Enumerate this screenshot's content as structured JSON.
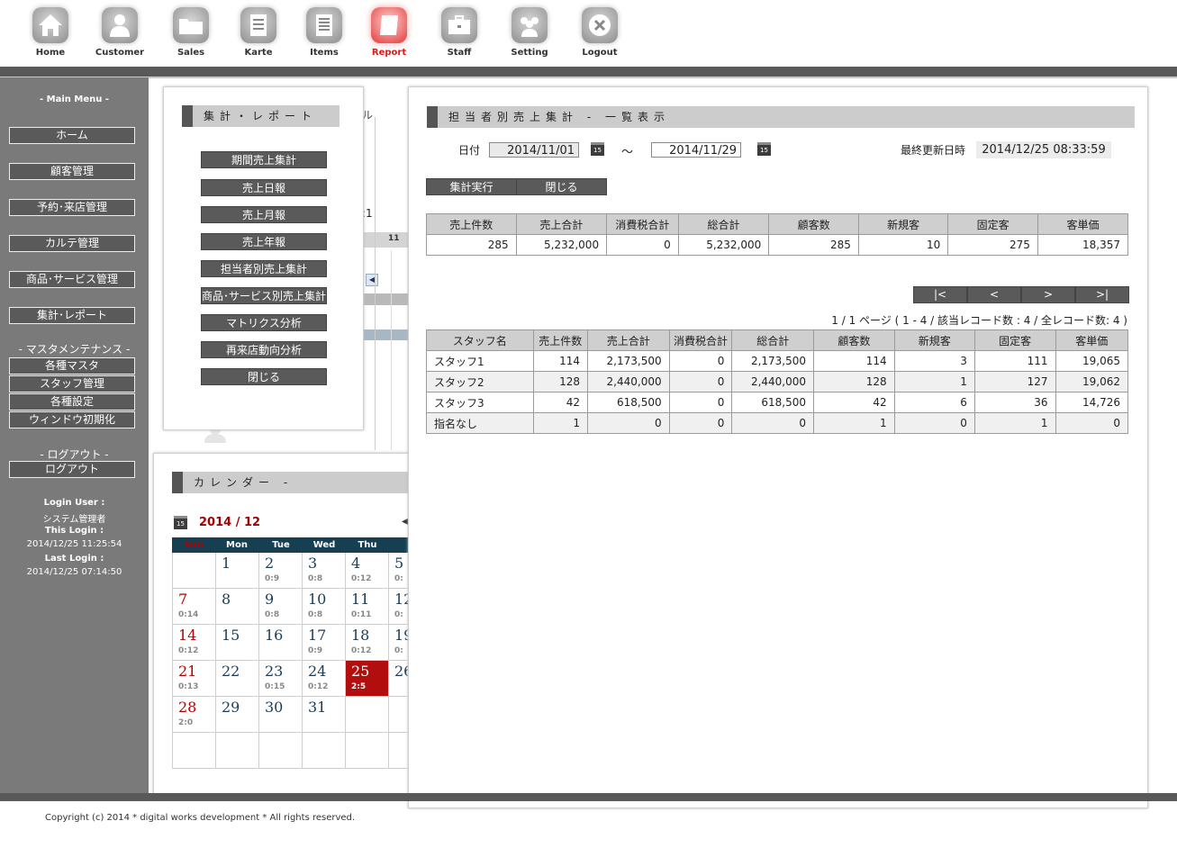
{
  "nav": [
    {
      "label": "Home",
      "icon": "home-icon"
    },
    {
      "label": "Customer",
      "icon": "person-icon"
    },
    {
      "label": "Sales",
      "icon": "folder-icon"
    },
    {
      "label": "Karte",
      "icon": "document-icon"
    },
    {
      "label": "Items",
      "icon": "list-document-icon"
    },
    {
      "label": "Report",
      "icon": "scroll-icon",
      "active": true
    },
    {
      "label": "Staff",
      "icon": "briefcase-icon"
    },
    {
      "label": "Setting",
      "icon": "group-icon"
    },
    {
      "label": "Logout",
      "icon": "close-circle-icon"
    }
  ],
  "sidebar": {
    "main_menu_head": "- Main Menu -",
    "items": [
      "ホーム",
      "顧客管理",
      "予約･来店管理",
      "カルテ管理",
      "商品･サービス管理",
      "集計･レポート"
    ],
    "master_head": "- マスタメンテナンス -",
    "master_items": [
      "各種マスタ",
      "スタッフ管理",
      "各種設定",
      "ウィンドウ初期化"
    ],
    "logout_head": "- ログアウト -",
    "logout_item": "ログアウト",
    "login_user_label": "Login User :",
    "login_user": "システム管理者",
    "this_login_label": "This Login :",
    "this_login": "2014/12/25 11:25:54",
    "last_login_label": "Last Login :",
    "last_login": "2014/12/25 07:14:50"
  },
  "report_menu": {
    "title": "集計・レポート",
    "items": [
      "期間売上集計",
      "売上日報",
      "売上月報",
      "売上年報",
      "担当者別売上集計",
      "商品･サービス別売上集計",
      "マトリクス分析",
      "再来店動向分析",
      "閉じる"
    ]
  },
  "background_fragments": {
    "title_tail": "ル",
    "ratio": ":1",
    "col11": "11"
  },
  "calendar": {
    "title": "カレンダー -",
    "month": "2014 / 12",
    "days": [
      "Sun",
      "Mon",
      "Tue",
      "Wed",
      "Thu"
    ],
    "rows": [
      [
        {
          "n": "",
          "s": ""
        },
        {
          "n": "1",
          "s": ""
        },
        {
          "n": "2",
          "s": "0:9"
        },
        {
          "n": "3",
          "s": "0:8"
        },
        {
          "n": "4",
          "s": "0:12"
        },
        {
          "n": "5",
          "s": "0:"
        }
      ],
      [
        {
          "n": "7",
          "s": "0:14"
        },
        {
          "n": "8",
          "s": ""
        },
        {
          "n": "9",
          "s": "0:8"
        },
        {
          "n": "10",
          "s": "0:8"
        },
        {
          "n": "11",
          "s": "0:11"
        },
        {
          "n": "12",
          "s": "0:"
        }
      ],
      [
        {
          "n": "14",
          "s": "0:12"
        },
        {
          "n": "15",
          "s": ""
        },
        {
          "n": "16",
          "s": ""
        },
        {
          "n": "17",
          "s": "0:9"
        },
        {
          "n": "18",
          "s": "0:12"
        },
        {
          "n": "19",
          "s": "0:"
        }
      ],
      [
        {
          "n": "21",
          "s": "0:13"
        },
        {
          "n": "22",
          "s": ""
        },
        {
          "n": "23",
          "s": "0:15"
        },
        {
          "n": "24",
          "s": "0:12"
        },
        {
          "n": "25",
          "s": "2:5",
          "today": true
        },
        {
          "n": "26",
          "s": ""
        }
      ],
      [
        {
          "n": "28",
          "s": "2:0"
        },
        {
          "n": "29",
          "s": ""
        },
        {
          "n": "30",
          "s": ""
        },
        {
          "n": "31",
          "s": ""
        },
        {
          "n": "",
          "s": ""
        },
        {
          "n": "",
          "s": ""
        }
      ],
      [
        {
          "n": "",
          "s": ""
        },
        {
          "n": "",
          "s": ""
        },
        {
          "n": "",
          "s": ""
        },
        {
          "n": "",
          "s": ""
        },
        {
          "n": "",
          "s": ""
        },
        {
          "n": "",
          "s": ""
        }
      ]
    ]
  },
  "report": {
    "title": "担当者別売上集計 - 一覧表示",
    "date_label": "日付",
    "date_from": "2014/11/01",
    "tilde": "～",
    "date_to": "2014/11/29",
    "updated_label": "最終更新日時",
    "updated_value": "2014/12/25 08:33:59",
    "run_label": "集計実行",
    "close_label": "閉じる",
    "summary_headers": [
      "売上件数",
      "売上合計",
      "消費税合計",
      "総合計",
      "顧客数",
      "新規客",
      "固定客",
      "客単価"
    ],
    "summary_values": [
      "285",
      "5,232,000",
      "0",
      "5,232,000",
      "285",
      "10",
      "275",
      "18,357"
    ],
    "pager": [
      "|<",
      "<",
      ">",
      ">|"
    ],
    "page_info": "1 / 1 ページ ( 1 - 4 / 該当レコード数 : 4 / 全レコード数: 4 )",
    "detail_headers": [
      "スタッフ名",
      "売上件数",
      "売上合計",
      "消費税合計",
      "総合計",
      "顧客数",
      "新規客",
      "固定客",
      "客単価"
    ],
    "detail_rows": [
      [
        "スタッフ1",
        "114",
        "2,173,500",
        "0",
        "2,173,500",
        "114",
        "3",
        "111",
        "19,065"
      ],
      [
        "スタッフ2",
        "128",
        "2,440,000",
        "0",
        "2,440,000",
        "128",
        "1",
        "127",
        "19,062"
      ],
      [
        "スタッフ3",
        "42",
        "618,500",
        "0",
        "618,500",
        "42",
        "6",
        "36",
        "14,726"
      ],
      [
        "指名なし",
        "1",
        "0",
        "0",
        "0",
        "1",
        "0",
        "1",
        "0"
      ]
    ]
  },
  "footer": "Copyright (c) 2014 * digital works development * All rights reserved."
}
